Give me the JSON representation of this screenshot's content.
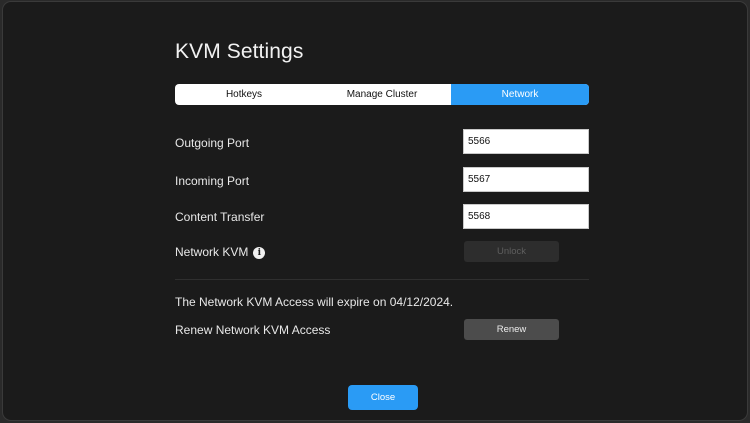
{
  "window": {
    "title": "KVM Settings"
  },
  "tabs": [
    {
      "label": "Hotkeys",
      "active": false
    },
    {
      "label": "Manage Cluster",
      "active": false
    },
    {
      "label": "Network",
      "active": true
    }
  ],
  "settings": {
    "outgoing_port": {
      "label": "Outgoing Port",
      "value": "5566"
    },
    "incoming_port": {
      "label": "Incoming Port",
      "value": "5567"
    },
    "content_transfer": {
      "label": "Content Transfer",
      "value": "5568"
    },
    "network_kvm": {
      "label": "Network KVM",
      "info_icon": "info-icon",
      "button_label": "Unlock",
      "button_enabled": false
    }
  },
  "access": {
    "expiry_text": "The Network KVM Access will expire on 04/12/2024.",
    "renew_label": "Renew Network KVM Access",
    "renew_button": "Renew"
  },
  "footer": {
    "close_label": "Close"
  },
  "colors": {
    "accent": "#2a9bf5",
    "background": "#1b1b1b"
  }
}
